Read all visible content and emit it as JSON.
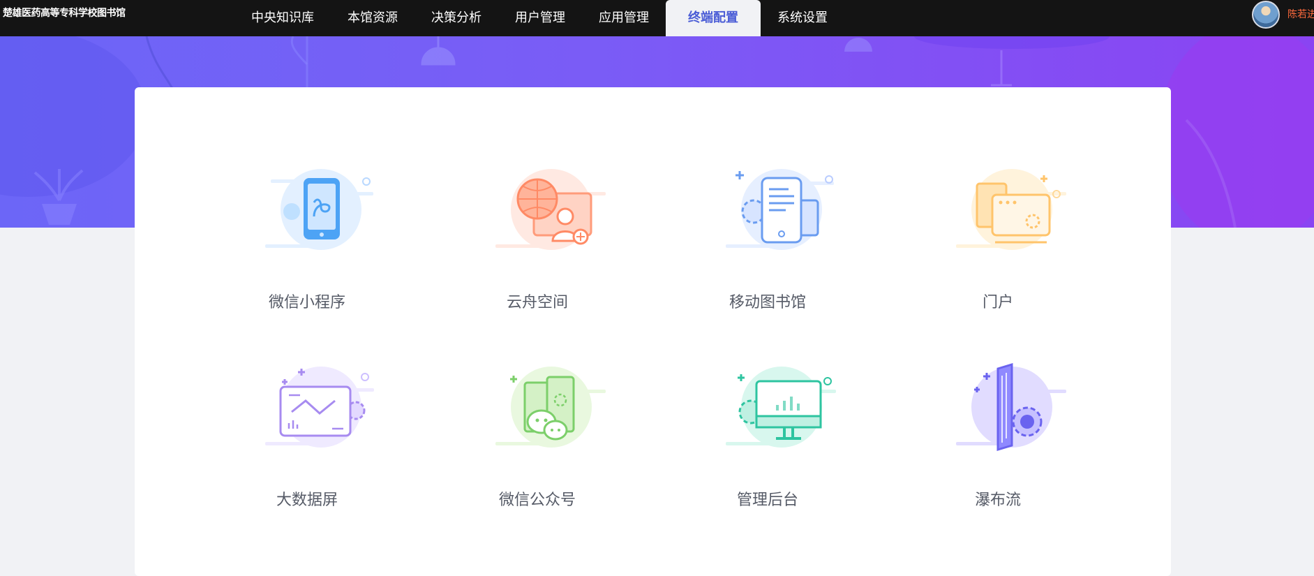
{
  "header": {
    "school_name": "楚雄医药高等专科学校图书馆",
    "user_name": "陈若进",
    "nav": [
      {
        "label": "中央知识库"
      },
      {
        "label": "本馆资源"
      },
      {
        "label": "决策分析"
      },
      {
        "label": "用户管理"
      },
      {
        "label": "应用管理"
      },
      {
        "label": "终端配置",
        "active": true
      },
      {
        "label": "系统设置"
      }
    ]
  },
  "tiles": [
    {
      "label": "微信小程序",
      "icon": "mini-program-phone-icon",
      "color": "#4da3f5"
    },
    {
      "label": "云舟空间",
      "icon": "globe-user-icon",
      "color": "#ff8a65"
    },
    {
      "label": "移动图书馆",
      "icon": "mobile-library-icon",
      "color": "#6a9cf0"
    },
    {
      "label": "门户",
      "icon": "portal-window-icon",
      "color": "#ffc46b"
    },
    {
      "label": "大数据屏",
      "icon": "big-data-screen-icon",
      "color": "#a78bf0"
    },
    {
      "label": "微信公众号",
      "icon": "wechat-official-icon",
      "color": "#7ccf6a"
    },
    {
      "label": "管理后台",
      "icon": "admin-monitor-icon",
      "color": "#2ec4a0"
    },
    {
      "label": "瀑布流",
      "icon": "waterfall-screen-icon",
      "color": "#6a63ef"
    }
  ]
}
